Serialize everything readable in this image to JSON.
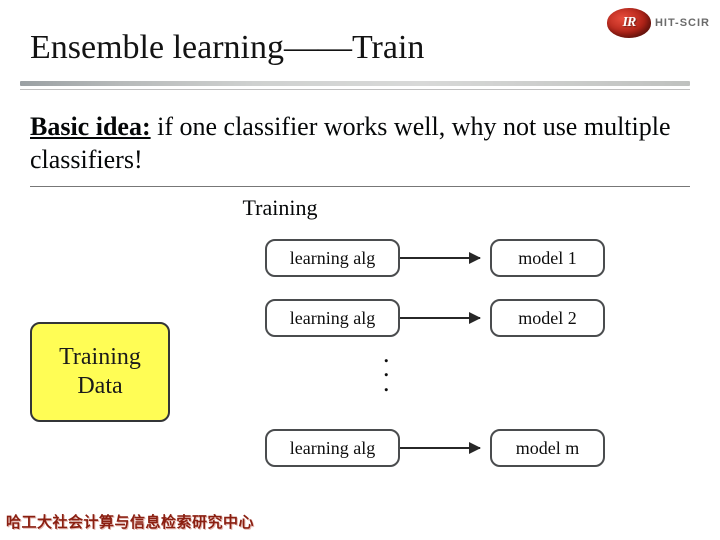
{
  "logo": {
    "mark": "IR",
    "label": "HIT-SCIR"
  },
  "title": "Ensemble learning——Train",
  "idea": {
    "lead": "Basic idea:",
    "rest": " if one classifier works well, why not use multiple classifiers!"
  },
  "section_label": "Training",
  "training_data_label": "Training\nData",
  "rows": [
    {
      "alg": "learning alg",
      "model": "model 1"
    },
    {
      "alg": "learning alg",
      "model": "model 2"
    },
    {
      "alg": "learning alg",
      "model": "model m"
    }
  ],
  "footer": "哈工大社会计算与信息检索研究中心"
}
